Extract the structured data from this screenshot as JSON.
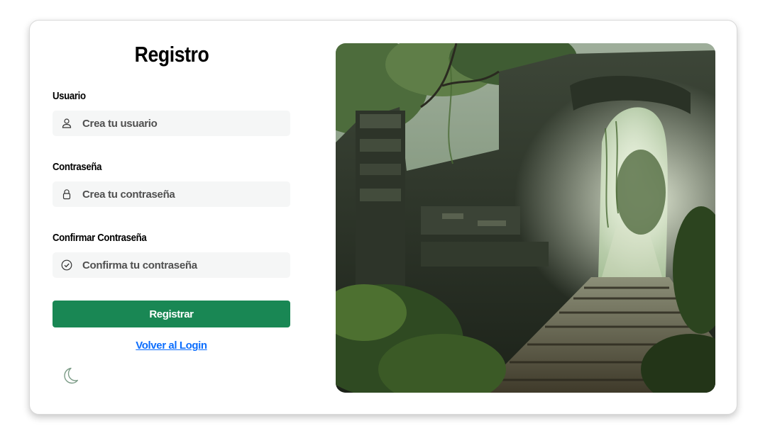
{
  "page": {
    "title": "Registro"
  },
  "form": {
    "username": {
      "label": "Usuario",
      "placeholder": "Crea tu usuario",
      "icon": "user-icon"
    },
    "password": {
      "label": "Contraseña",
      "placeholder": "Crea tu contraseña",
      "icon": "lock-icon"
    },
    "confirm_password": {
      "label": "Confirmar Contraseña",
      "placeholder": "Confirma tu contraseña",
      "icon": "check-circle-icon"
    },
    "submit_label": "Registrar",
    "back_link": "Volver al Login"
  },
  "theme_toggle": {
    "icon": "moon-icon"
  },
  "colors": {
    "primary_button": "#198754",
    "link": "#0d6efd",
    "field_background": "#f5f6f6"
  },
  "image": {
    "subject": "overgrown-jungle-temple-ruins"
  }
}
